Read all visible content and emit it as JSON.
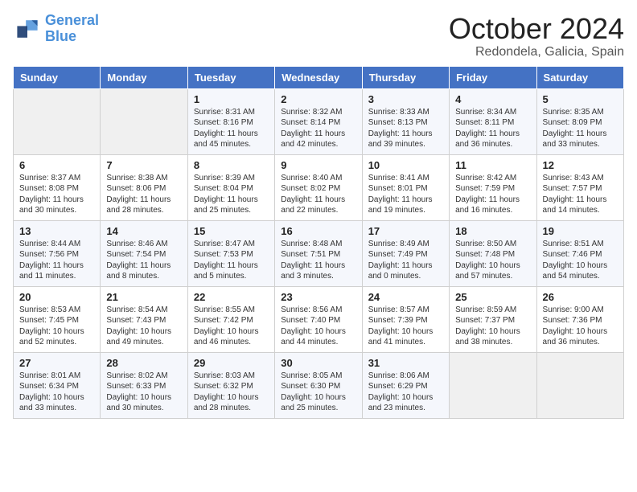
{
  "header": {
    "logo_line1": "General",
    "logo_line2": "Blue",
    "month": "October 2024",
    "location": "Redondela, Galicia, Spain"
  },
  "columns": [
    "Sunday",
    "Monday",
    "Tuesday",
    "Wednesday",
    "Thursday",
    "Friday",
    "Saturday"
  ],
  "weeks": [
    [
      {
        "day": "",
        "info": ""
      },
      {
        "day": "",
        "info": ""
      },
      {
        "day": "1",
        "info": "Sunrise: 8:31 AM\nSunset: 8:16 PM\nDaylight: 11 hours and 45 minutes."
      },
      {
        "day": "2",
        "info": "Sunrise: 8:32 AM\nSunset: 8:14 PM\nDaylight: 11 hours and 42 minutes."
      },
      {
        "day": "3",
        "info": "Sunrise: 8:33 AM\nSunset: 8:13 PM\nDaylight: 11 hours and 39 minutes."
      },
      {
        "day": "4",
        "info": "Sunrise: 8:34 AM\nSunset: 8:11 PM\nDaylight: 11 hours and 36 minutes."
      },
      {
        "day": "5",
        "info": "Sunrise: 8:35 AM\nSunset: 8:09 PM\nDaylight: 11 hours and 33 minutes."
      }
    ],
    [
      {
        "day": "6",
        "info": "Sunrise: 8:37 AM\nSunset: 8:08 PM\nDaylight: 11 hours and 30 minutes."
      },
      {
        "day": "7",
        "info": "Sunrise: 8:38 AM\nSunset: 8:06 PM\nDaylight: 11 hours and 28 minutes."
      },
      {
        "day": "8",
        "info": "Sunrise: 8:39 AM\nSunset: 8:04 PM\nDaylight: 11 hours and 25 minutes."
      },
      {
        "day": "9",
        "info": "Sunrise: 8:40 AM\nSunset: 8:02 PM\nDaylight: 11 hours and 22 minutes."
      },
      {
        "day": "10",
        "info": "Sunrise: 8:41 AM\nSunset: 8:01 PM\nDaylight: 11 hours and 19 minutes."
      },
      {
        "day": "11",
        "info": "Sunrise: 8:42 AM\nSunset: 7:59 PM\nDaylight: 11 hours and 16 minutes."
      },
      {
        "day": "12",
        "info": "Sunrise: 8:43 AM\nSunset: 7:57 PM\nDaylight: 11 hours and 14 minutes."
      }
    ],
    [
      {
        "day": "13",
        "info": "Sunrise: 8:44 AM\nSunset: 7:56 PM\nDaylight: 11 hours and 11 minutes."
      },
      {
        "day": "14",
        "info": "Sunrise: 8:46 AM\nSunset: 7:54 PM\nDaylight: 11 hours and 8 minutes."
      },
      {
        "day": "15",
        "info": "Sunrise: 8:47 AM\nSunset: 7:53 PM\nDaylight: 11 hours and 5 minutes."
      },
      {
        "day": "16",
        "info": "Sunrise: 8:48 AM\nSunset: 7:51 PM\nDaylight: 11 hours and 3 minutes."
      },
      {
        "day": "17",
        "info": "Sunrise: 8:49 AM\nSunset: 7:49 PM\nDaylight: 11 hours and 0 minutes."
      },
      {
        "day": "18",
        "info": "Sunrise: 8:50 AM\nSunset: 7:48 PM\nDaylight: 10 hours and 57 minutes."
      },
      {
        "day": "19",
        "info": "Sunrise: 8:51 AM\nSunset: 7:46 PM\nDaylight: 10 hours and 54 minutes."
      }
    ],
    [
      {
        "day": "20",
        "info": "Sunrise: 8:53 AM\nSunset: 7:45 PM\nDaylight: 10 hours and 52 minutes."
      },
      {
        "day": "21",
        "info": "Sunrise: 8:54 AM\nSunset: 7:43 PM\nDaylight: 10 hours and 49 minutes."
      },
      {
        "day": "22",
        "info": "Sunrise: 8:55 AM\nSunset: 7:42 PM\nDaylight: 10 hours and 46 minutes."
      },
      {
        "day": "23",
        "info": "Sunrise: 8:56 AM\nSunset: 7:40 PM\nDaylight: 10 hours and 44 minutes."
      },
      {
        "day": "24",
        "info": "Sunrise: 8:57 AM\nSunset: 7:39 PM\nDaylight: 10 hours and 41 minutes."
      },
      {
        "day": "25",
        "info": "Sunrise: 8:59 AM\nSunset: 7:37 PM\nDaylight: 10 hours and 38 minutes."
      },
      {
        "day": "26",
        "info": "Sunrise: 9:00 AM\nSunset: 7:36 PM\nDaylight: 10 hours and 36 minutes."
      }
    ],
    [
      {
        "day": "27",
        "info": "Sunrise: 8:01 AM\nSunset: 6:34 PM\nDaylight: 10 hours and 33 minutes."
      },
      {
        "day": "28",
        "info": "Sunrise: 8:02 AM\nSunset: 6:33 PM\nDaylight: 10 hours and 30 minutes."
      },
      {
        "day": "29",
        "info": "Sunrise: 8:03 AM\nSunset: 6:32 PM\nDaylight: 10 hours and 28 minutes."
      },
      {
        "day": "30",
        "info": "Sunrise: 8:05 AM\nSunset: 6:30 PM\nDaylight: 10 hours and 25 minutes."
      },
      {
        "day": "31",
        "info": "Sunrise: 8:06 AM\nSunset: 6:29 PM\nDaylight: 10 hours and 23 minutes."
      },
      {
        "day": "",
        "info": ""
      },
      {
        "day": "",
        "info": ""
      }
    ]
  ]
}
